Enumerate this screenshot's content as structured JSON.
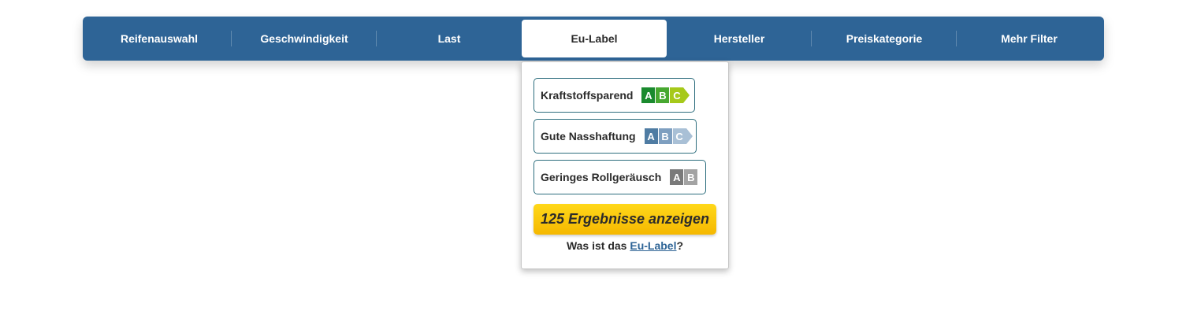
{
  "nav": {
    "tabs": [
      {
        "label": "Reifenauswahl"
      },
      {
        "label": "Geschwindigkeit"
      },
      {
        "label": "Last"
      },
      {
        "label": "Eu-Label",
        "active": true
      },
      {
        "label": "Hersteller"
      },
      {
        "label": "Preiskategorie"
      },
      {
        "label": "Mehr Filter"
      }
    ]
  },
  "eu_label_dropdown": {
    "options": [
      {
        "label": "Kraftstoffsparend",
        "grades": [
          "A",
          "B",
          "C"
        ],
        "colors": [
          "#1a8a2e",
          "#47a830",
          "#a6c91a"
        ],
        "arrow_color": "#a6c91a"
      },
      {
        "label": "Gute Nasshaftung",
        "grades": [
          "A",
          "B",
          "C"
        ],
        "colors": [
          "#4f7ca3",
          "#7e9fc0",
          "#a9c0d6"
        ],
        "arrow_color": "#a9c0d6"
      },
      {
        "label": "Geringes Rollgeräusch",
        "grades": [
          "A",
          "B"
        ],
        "colors": [
          "#7a7a7a",
          "#a3a3a3"
        ]
      }
    ],
    "cta_label": "125 Ergebnisse anzeigen",
    "info_prefix": "Was ist das ",
    "info_link": "Eu-Label",
    "info_suffix": "?"
  },
  "colors": {
    "nav_bg": "#2e6496",
    "cta_yellow": "#f5b800",
    "option_border": "#2e6e7e"
  }
}
